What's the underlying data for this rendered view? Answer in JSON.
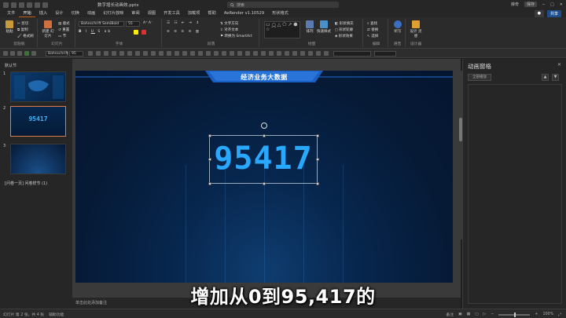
{
  "window": {
    "doc_title": "数字增长动画效.pptx",
    "search_placeholder": "搜索",
    "user": "薛奇",
    "user_tag": "保存"
  },
  "ribbon_tabs": [
    "文件",
    "开始",
    "插入",
    "设计",
    "切换",
    "动画",
    "幻灯片放映",
    "审阅",
    "视图",
    "开发工具",
    "加载项",
    "帮助",
    "AeRender v1.10529",
    "形状格式"
  ],
  "active_tab": "开始",
  "tab_buttons": {
    "share": "共享"
  },
  "ribbon": {
    "clipboard": {
      "label": "剪贴板",
      "paste": "粘贴",
      "cut": "剪切",
      "copy": "复制",
      "format_painter": "格式刷"
    },
    "slides": {
      "label": "幻灯片",
      "new_slide": "新建\n幻灯片",
      "reuse": "重用\n幻灯片",
      "layout": "版式",
      "reset": "重置",
      "section": "节"
    },
    "font": {
      "label": "字体",
      "font_name": "Bahnschrift SemiBold",
      "font_size": "55"
    },
    "paragraph": {
      "label": "段落",
      "text_direction": "文字方向",
      "align_text": "对齐文本",
      "smartart": "转换为 SmartArt"
    },
    "drawing": {
      "label": "绘图",
      "arrange": "排列",
      "quick_styles": "快速样式",
      "shape_fill": "形状填充",
      "shape_outline": "形状轮廓",
      "shape_effects": "形状效果"
    },
    "editing": {
      "label": "编辑",
      "find": "查找",
      "replace": "替换",
      "select": "选择"
    },
    "voice": {
      "label": "语音",
      "dictate": "听写"
    },
    "designer": {
      "label": "设计器",
      "designer_btn": "设计\n灵感"
    }
  },
  "format_bar": {
    "font_name": "Bahnschrift",
    "font_size": "95"
  },
  "thumbnails": {
    "section_top": "默认节",
    "section_bottom": "[问卷一页] 问卷样节 (1)",
    "slides": [
      {
        "num": "1",
        "content": ""
      },
      {
        "num": "2",
        "content": "95417"
      },
      {
        "num": "3",
        "content": ""
      }
    ]
  },
  "slide": {
    "title": "经济业务大数据",
    "number": "95417"
  },
  "notes": {
    "placeholder": "单击此处添加备注"
  },
  "animation_pane": {
    "title": "动画窗格",
    "play": "全部播放"
  },
  "status": {
    "slide_info": "幻灯片 第 2 张，共 4 张",
    "accessibility": "辅助功能",
    "notes": "备注",
    "zoom": "100%"
  },
  "subtitle": "增加从0到95,417的",
  "colors": {
    "accent_orange": "#c55a11",
    "number_blue": "#29a8ff",
    "slide_bg": "#061a36"
  }
}
